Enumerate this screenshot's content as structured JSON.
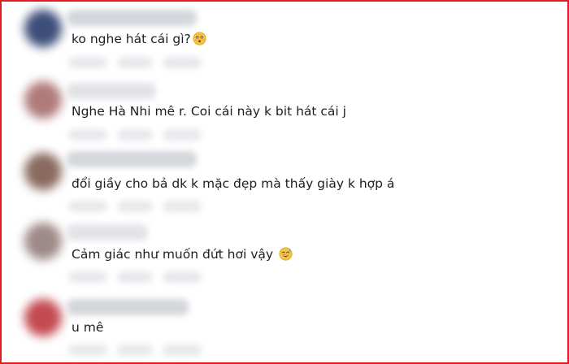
{
  "comments": [
    {
      "text": "ko nghe hát cái gì?",
      "emoji": "astonished-face-icon",
      "avatar_color": "#3d4e7a"
    },
    {
      "text": "Nghe Hà Nhi mê r. Coi cái này k bit hát cái j",
      "emoji": null,
      "avatar_color": "#b07a7a"
    },
    {
      "text": "đổi giầy cho bả dk k mặc đẹp mà thấy giày k hợp á",
      "emoji": null,
      "avatar_color": "#8a6a5e"
    },
    {
      "text": "Cảm giác như muốn đứt hơi vậy",
      "emoji": "sweat-smile-icon",
      "avatar_color": "#9e8a88"
    },
    {
      "text": "u mê",
      "emoji": null,
      "avatar_color": "#c44a52"
    }
  ],
  "colors": {
    "border": "#e01b24",
    "text": "#1c1e21",
    "blur_gray": "#d3d6db"
  }
}
